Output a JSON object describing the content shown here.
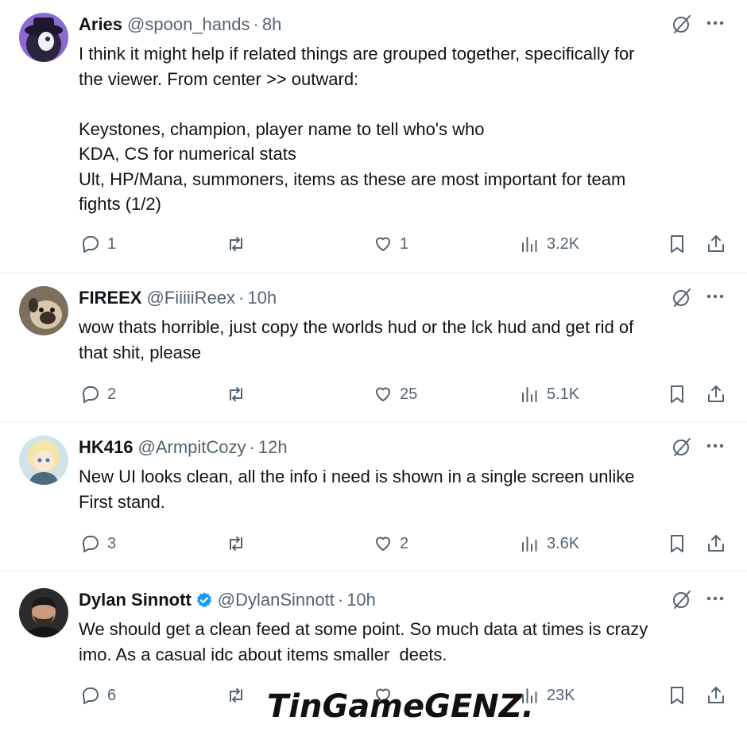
{
  "tweets": [
    {
      "name": "Aries",
      "handle": "@spoon_hands",
      "sep": "·",
      "time": "8h",
      "verified": false,
      "avatar_icon": "masked-character-avatar",
      "text": "I think it might help if related things are grouped together, specifically for\nthe viewer. From center >> outward:\n\nKeystones, champion, player name to tell who's who\nKDA, CS for numerical stats\nUlt, HP/Mana, summoners, items as these are most important for team\nfights (1/2)",
      "replies": "1",
      "reposts": "",
      "likes": "1",
      "views": "3.2K"
    },
    {
      "name": "FIREEX",
      "handle": "@FiiiiiReex",
      "sep": "·",
      "time": "10h",
      "verified": false,
      "avatar_icon": "pug-avatar",
      "text": "wow thats horrible, just copy the worlds hud or the lck hud and get rid of\nthat shit, please",
      "replies": "2",
      "reposts": "",
      "likes": "25",
      "views": "5.1K"
    },
    {
      "name": "HK416",
      "handle": "@ArmpitCozy",
      "sep": "·",
      "time": "12h",
      "verified": false,
      "avatar_icon": "anime-girl-avatar",
      "text": "New UI looks clean, all the info i need is shown in a single screen unlike\nFirst stand.",
      "replies": "3",
      "reposts": "",
      "likes": "2",
      "views": "3.6K"
    },
    {
      "name": "Dylan Sinnott",
      "handle": "@DylanSinnott",
      "sep": "·",
      "time": "10h",
      "verified": true,
      "avatar_icon": "bearded-man-avatar",
      "text": "We should get a clean feed at some point. So much data at times is crazy\nimo. As a casual idc about items smaller  deets.",
      "replies": "6",
      "reposts": "",
      "likes": "",
      "views": "23K"
    }
  ],
  "watermark": {
    "part1": "TinGame",
    "part2": "GENZ."
  },
  "colors": {
    "text": "#0f1419",
    "muted": "#536471",
    "verified": "#1d9bf0",
    "divider": "#eff3f4"
  }
}
